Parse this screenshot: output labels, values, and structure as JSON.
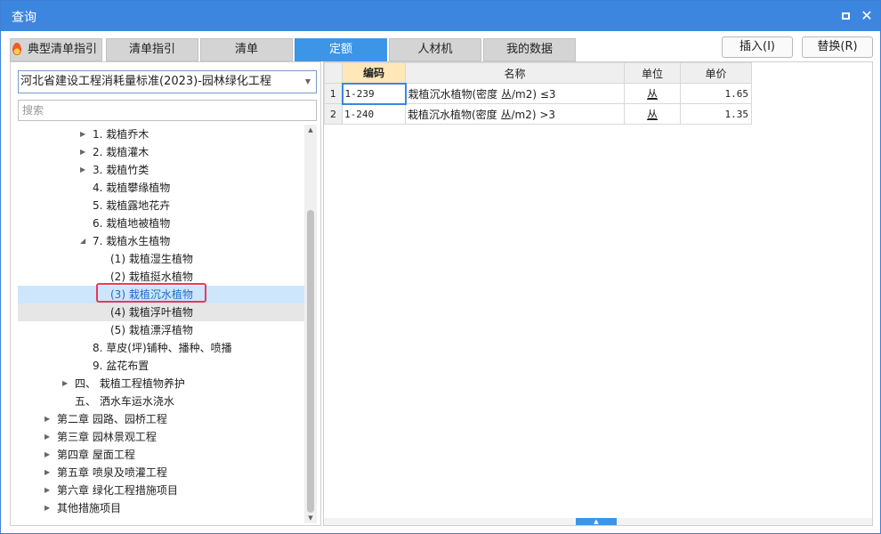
{
  "window": {
    "title": "查询",
    "maximize_icon": "maximize-icon",
    "close_label": "✕"
  },
  "tabs": [
    {
      "label": "典型清单指引",
      "icon": "flame-icon"
    },
    {
      "label": "清单指引"
    },
    {
      "label": "清单"
    },
    {
      "label": "定额",
      "active": true
    },
    {
      "label": "人材机"
    },
    {
      "label": "我的数据"
    }
  ],
  "actions": {
    "insert": "插入(I)",
    "replace": "替换(R)"
  },
  "left": {
    "standard_select": "河北省建设工程消耗量标准(2023)-园林绿化工程",
    "search_placeholder": "搜索"
  },
  "tree": [
    {
      "label": "1. 栽植乔木",
      "expandable": true
    },
    {
      "label": "2. 栽植灌木",
      "expandable": true
    },
    {
      "label": "3. 栽植竹类",
      "expandable": true
    },
    {
      "label": "4. 栽植攀缘植物"
    },
    {
      "label": "5. 栽植露地花卉"
    },
    {
      "label": "6. 栽植地被植物"
    },
    {
      "label": "7. 栽植水生植物",
      "expanded": true
    },
    {
      "label": "(1) 栽植湿生植物"
    },
    {
      "label": "(2) 栽植挺水植物"
    },
    {
      "label": "(3) 栽植沉水植物",
      "selected": true
    },
    {
      "label": "(4) 栽植浮叶植物"
    },
    {
      "label": "(5) 栽植漂浮植物"
    },
    {
      "label": "8. 草皮(坪)铺种、播种、喷播"
    },
    {
      "label": "9. 盆花布置"
    },
    {
      "label": "四、 栽植工程植物养护",
      "expandable": true
    },
    {
      "label": "五、 洒水车运水浇水"
    },
    {
      "label": "第二章 园路、园桥工程",
      "expandable": true
    },
    {
      "label": "第三章 园林景观工程",
      "expandable": true
    },
    {
      "label": "第四章 屋面工程",
      "expandable": true
    },
    {
      "label": "第五章 喷泉及喷灌工程",
      "expandable": true
    },
    {
      "label": "第六章 绿化工程措施项目",
      "expandable": true
    },
    {
      "label": "其他措施项目",
      "expandable": true
    }
  ],
  "grid": {
    "headers": [
      "编码",
      "名称",
      "单位",
      "单价"
    ],
    "rows": [
      {
        "index": "1",
        "code": "1-239",
        "name": "栽植沉水植物(密度 丛/m2) ≤3",
        "unit": "丛",
        "price": "1.65"
      },
      {
        "index": "2",
        "code": "1-240",
        "name": "栽植沉水植物(密度 丛/m2) >3",
        "unit": "丛",
        "price": "1.35"
      }
    ]
  }
}
